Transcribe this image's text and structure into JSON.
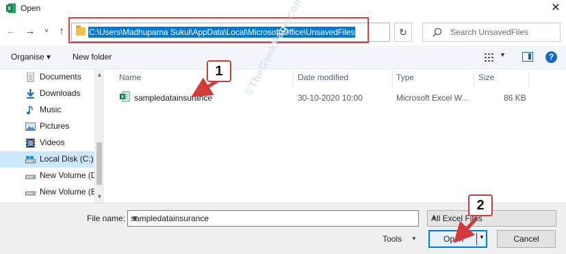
{
  "window": {
    "title": "Open",
    "close_glyph": "✕",
    "app_icon": "excel-icon"
  },
  "nav": {
    "back": "←",
    "forward": "→",
    "recent": "˅",
    "up": "↑",
    "refresh": "↻"
  },
  "address": {
    "path": "C:\\Users\\Madhuparna Sukul\\AppData\\Local\\Microsoft\\Office\\UnsavedFiles",
    "dropdown": "˅"
  },
  "search": {
    "placeholder": "Search UnsavedFiles"
  },
  "toolbar": {
    "organise": "Organise ▾",
    "new_folder": "New folder",
    "help": "?"
  },
  "sidebar": {
    "items": [
      {
        "label": "Documents",
        "icon": "documents-icon"
      },
      {
        "label": "Downloads",
        "icon": "downloads-icon"
      },
      {
        "label": "Music",
        "icon": "music-icon"
      },
      {
        "label": "Pictures",
        "icon": "pictures-icon"
      },
      {
        "label": "Videos",
        "icon": "videos-icon"
      },
      {
        "label": "Local Disk (C:)",
        "icon": "drive-icon",
        "selected": true
      },
      {
        "label": "New Volume (D",
        "icon": "drive-icon"
      },
      {
        "label": "New Volume (E",
        "icon": "drive-icon"
      }
    ]
  },
  "columns": {
    "name": "Name",
    "date": "Date modified",
    "type": "Type",
    "size": "Size"
  },
  "files": [
    {
      "name": "sampledatainsurance",
      "date": "30-10-2020 10:00",
      "type": "Microsoft Excel W...",
      "size": "86 KB",
      "icon": "excel-file-icon"
    }
  ],
  "watermark": "©TheGeekPage.com",
  "bottom": {
    "filename_label": "File name:",
    "filename_value": "sampledatainsurance",
    "filetype_value": "All Excel Files",
    "tools": "Tools",
    "open": "Open",
    "cancel": "Cancel"
  },
  "callouts": [
    "1",
    "2"
  ],
  "colors": {
    "accent": "#0078d7",
    "callout_red": "#d23a3a",
    "selection": "#cce8ff"
  }
}
